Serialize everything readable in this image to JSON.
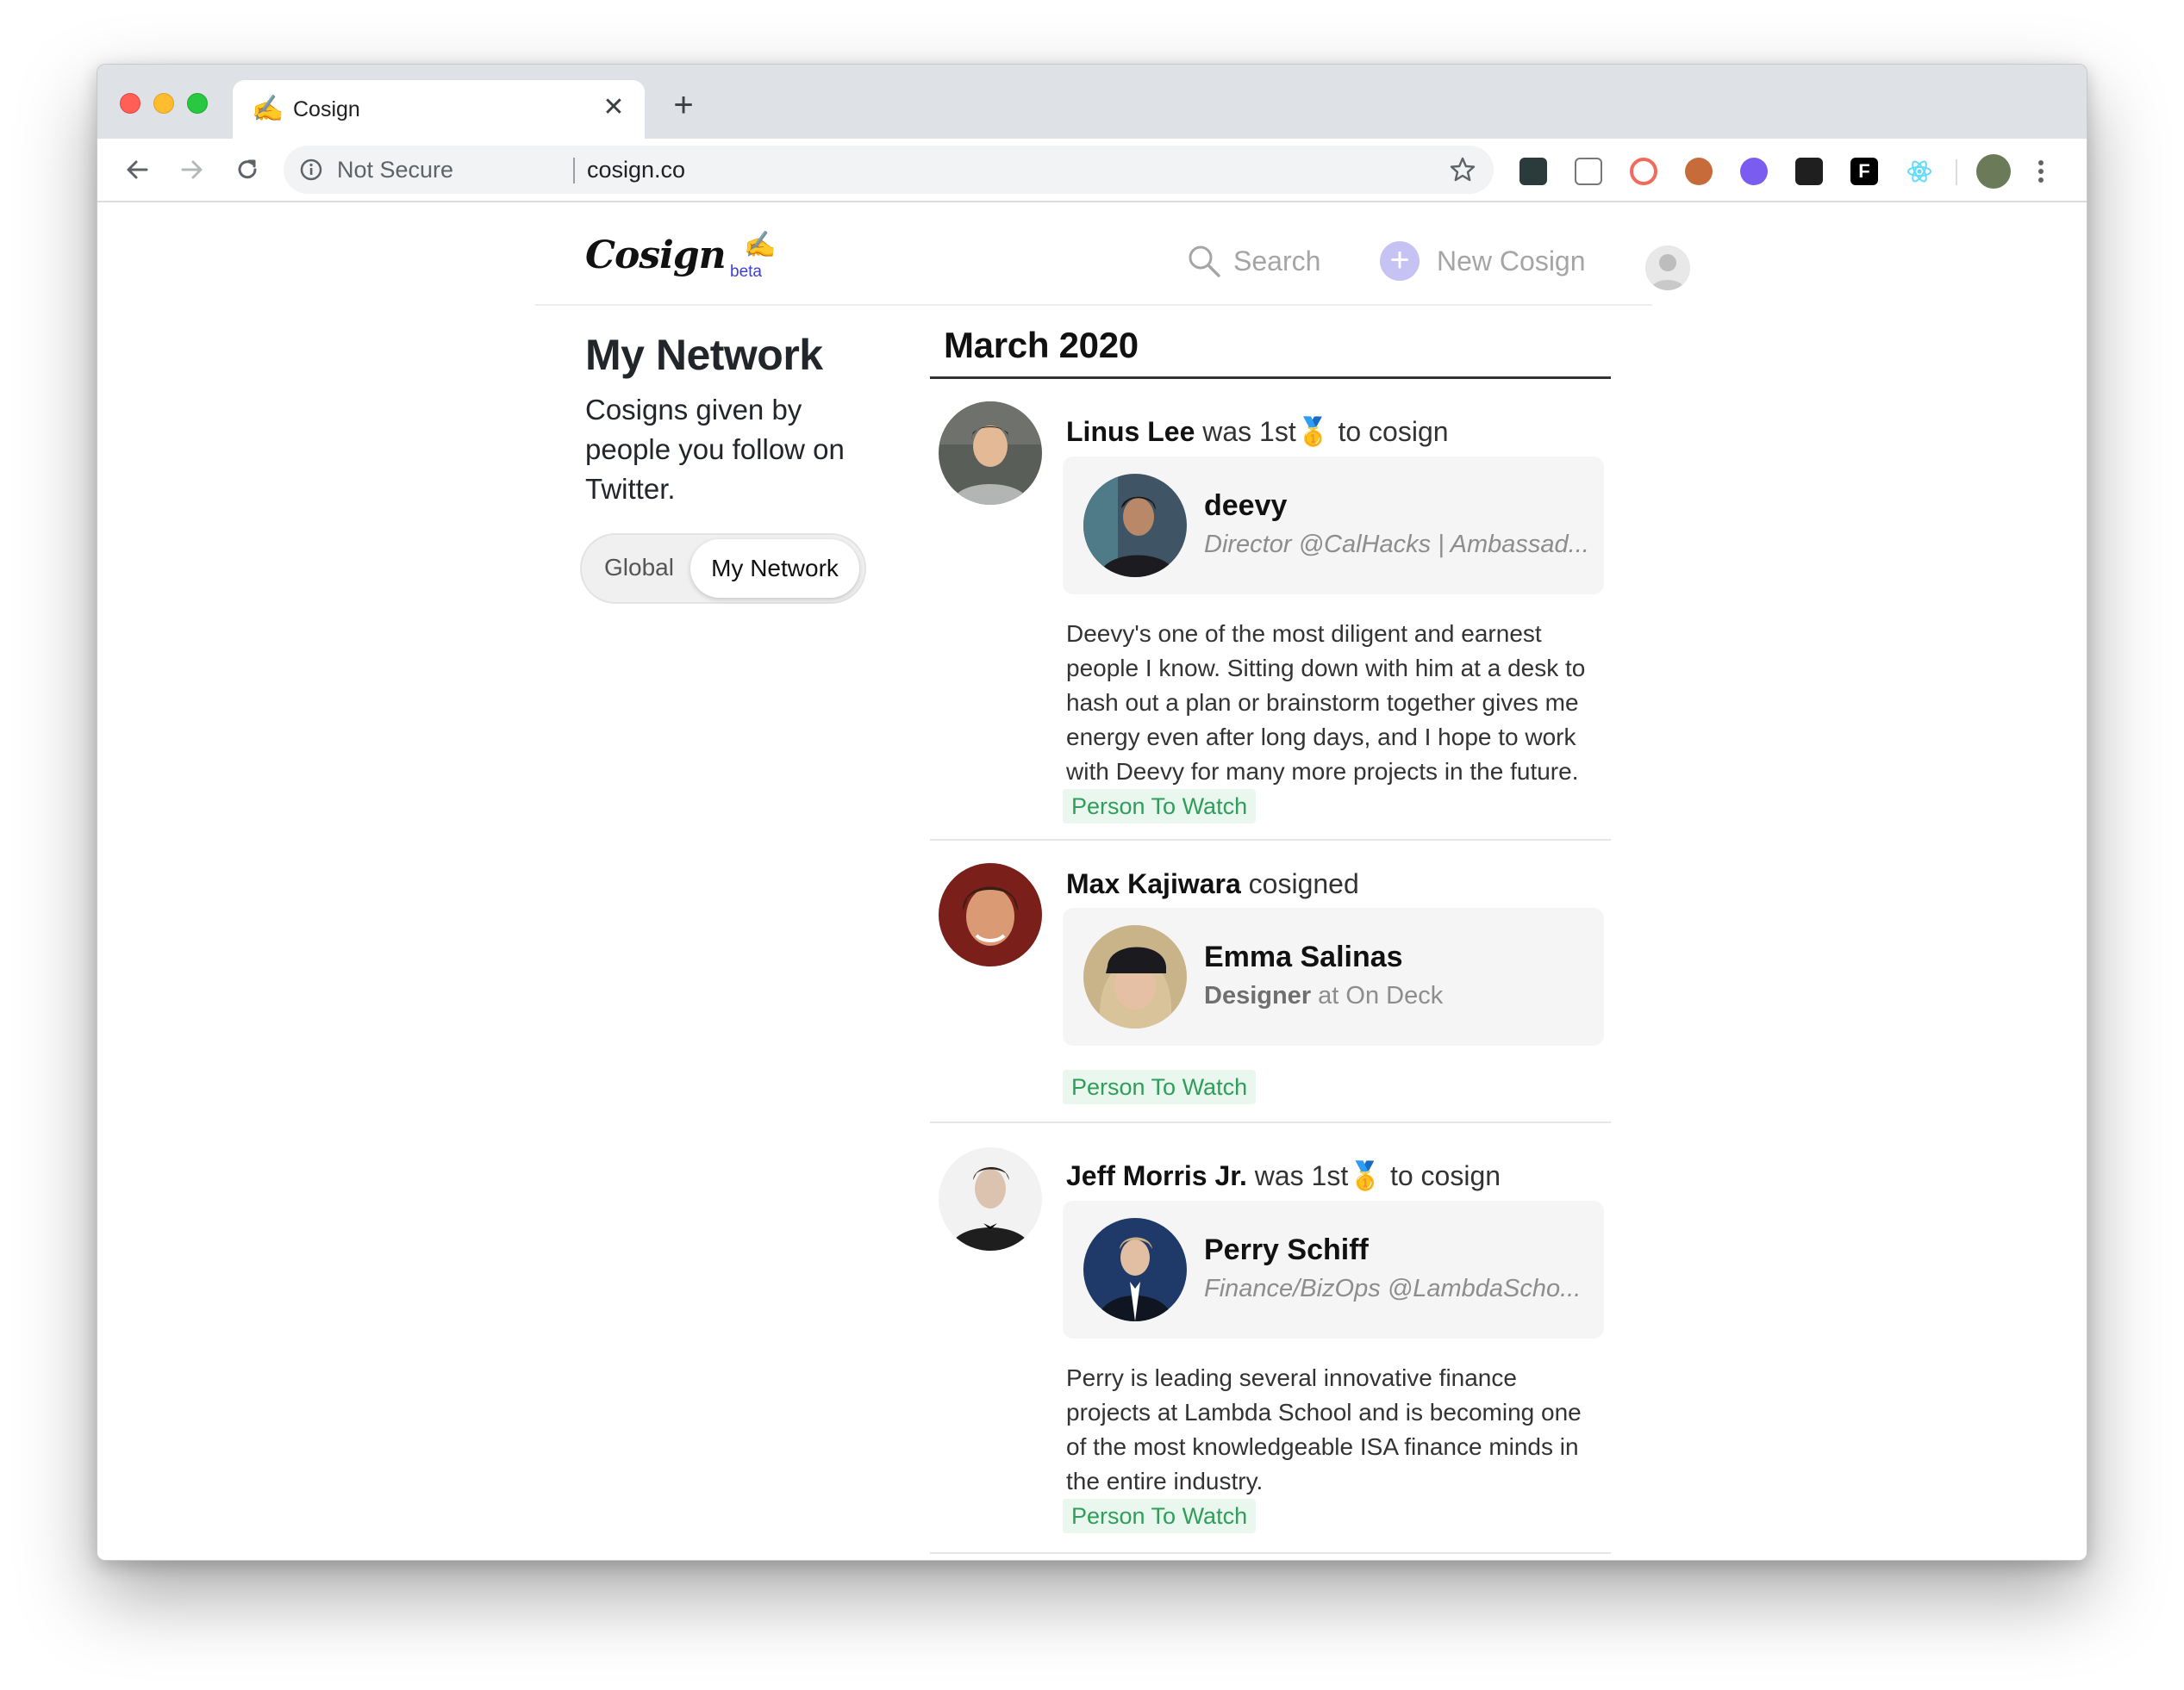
{
  "browser": {
    "tab_title": "Cosign",
    "tab_favicon": "✍️",
    "security_label": "Not Secure",
    "url": "cosign.co"
  },
  "site": {
    "logo_text": "Cosign",
    "logo_badge": "beta",
    "search_label": "Search",
    "new_cosign_label": "New Cosign"
  },
  "sidebar": {
    "title": "My Network",
    "subtitle": "Cosigns given by people you follow on Twitter.",
    "segments": [
      "Global",
      "My Network"
    ],
    "selected_segment": "My Network"
  },
  "feed": {
    "month": "March 2020",
    "entries": [
      {
        "actor": "Linus Lee",
        "action_prefix": "was 1st",
        "medal": "🥇",
        "action_suffix": "to cosign",
        "subject": "deevy",
        "subject_title": "Director @CalHacks | Ambassad...",
        "quote": "Deevy's one of the most diligent and earnest people I know. Sitting down with him at a desk to hash out a plan or brainstorm together gives me energy even after long days, and I hope to work with Deevy for many more projects in the future.",
        "tag": "Person To Watch"
      },
      {
        "actor": "Max Kajiwara",
        "action_prefix": "cosigned",
        "subject": "Emma Salinas",
        "subject_role": "Designer",
        "subject_at": "at On Deck",
        "tag": "Person To Watch"
      },
      {
        "actor": "Jeff Morris Jr.",
        "action_prefix": "was 1st",
        "medal": "🥇",
        "action_suffix": "to cosign",
        "subject": "Perry Schiff",
        "subject_title": "Finance/BizOps @LambdaScho...",
        "quote": "Perry is leading several innovative finance projects at Lambda School and is becoming one of the most knowledgeable ISA finance minds in the entire industry.",
        "tag": "Person To Watch"
      }
    ]
  },
  "colors": {
    "accent_purple": "#c6c2f3",
    "tag_green": "#2f9e5a",
    "tag_bg": "#eaf7ef",
    "beta_blue": "#3b3fd8"
  }
}
